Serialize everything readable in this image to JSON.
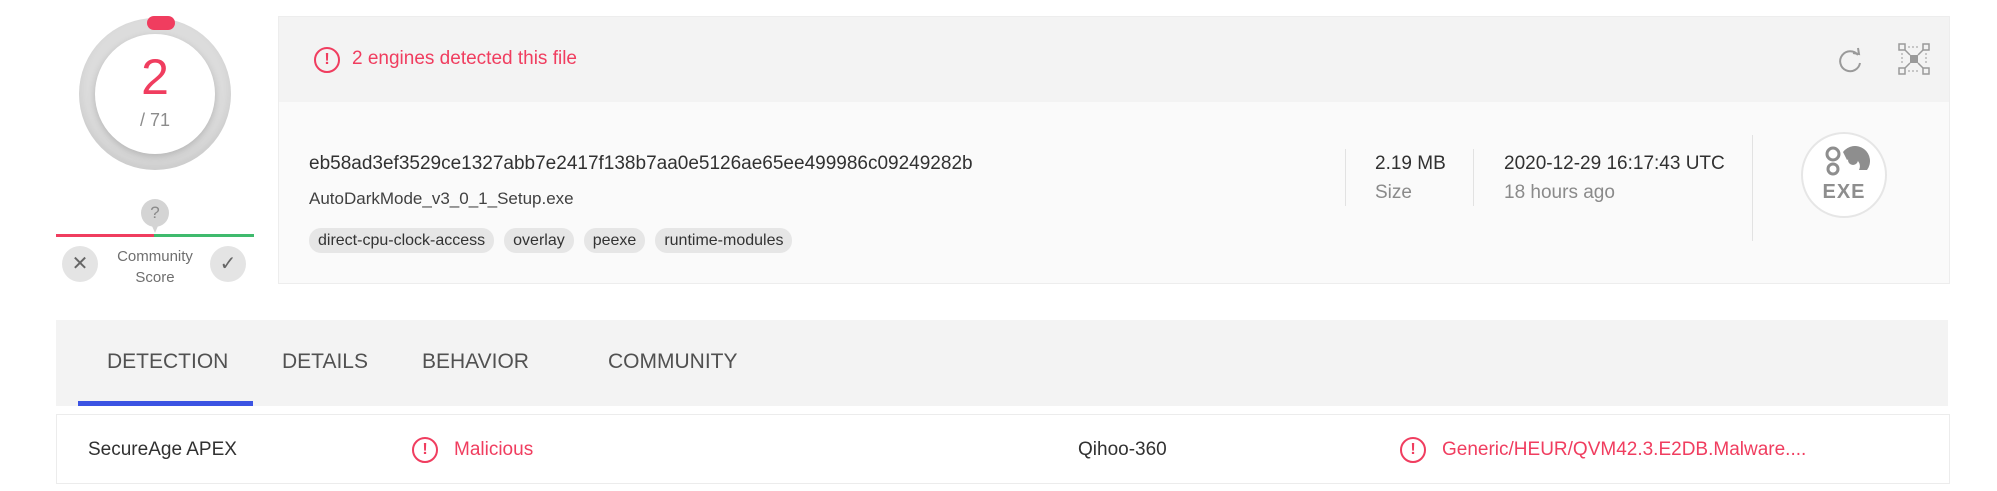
{
  "score": {
    "positives": "2",
    "total": "/ 71",
    "community_label": "Community\nScore",
    "help_glyph": "?"
  },
  "alert": {
    "text": "2 engines detected this file",
    "color": "#f03d5f"
  },
  "file": {
    "hash": "eb58ad3ef3529ce1327abb7e2417f138b7aa0e5126ae65ee499986c09249282b",
    "name": "AutoDarkMode_v3_0_1_Setup.exe",
    "tags": [
      "direct-cpu-clock-access",
      "overlay",
      "peexe",
      "runtime-modules"
    ],
    "size_value": "2.19 MB",
    "size_label": "Size",
    "date_value": "2020-12-29 16:17:43 UTC",
    "date_relative": "18 hours ago",
    "type_badge": "EXE"
  },
  "tabs": [
    {
      "label": "DETECTION",
      "active": true
    },
    {
      "label": "DETAILS",
      "active": false
    },
    {
      "label": "BEHAVIOR",
      "active": false
    },
    {
      "label": "COMMUNITY",
      "active": false
    }
  ],
  "detections": [
    {
      "engine": "SecureAge APEX",
      "result": "Malicious"
    },
    {
      "engine": "Qihoo-360",
      "result": "Generic/HEUR/QVM42.3.E2DB.Malware...."
    }
  ],
  "icons": {
    "alert": "exclamation-circle-icon",
    "reanalyze": "reanalyze-icon",
    "graph": "graph-icon",
    "vote_down": "close-icon",
    "vote_up": "check-icon",
    "file_type": "exe-file-icon"
  },
  "colors": {
    "malicious": "#f03d5f",
    "harmless": "#3fba6d",
    "active_tab": "#3b53e3"
  }
}
